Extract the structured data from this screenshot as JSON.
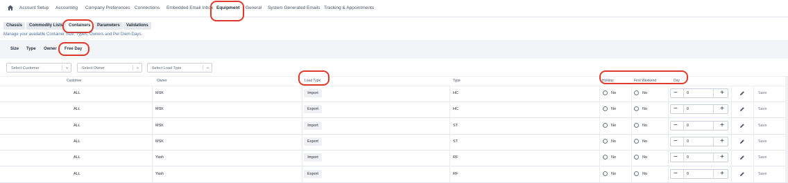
{
  "nav": {
    "items": [
      "Account Setup",
      "Accounting",
      "Company Preferences",
      "Connections",
      "Embedded Email Inbox",
      "Equipment",
      "General",
      "System Generated Emails",
      "Tracking & Appointments"
    ],
    "active": "Equipment"
  },
  "subtabs": [
    "Chassis",
    "Commodity Lists",
    "Containers",
    "Parameters",
    "Validations"
  ],
  "description": "Manage your available Container Size, Types, Owners and Per Diem Days.",
  "pills": [
    "Size",
    "Type",
    "Owner",
    "Free Day"
  ],
  "filters": [
    {
      "placeholder": "Select Customer"
    },
    {
      "placeholder": "Select Owner"
    },
    {
      "placeholder": "Select Load Type"
    }
  ],
  "columns": {
    "customer": "Customer",
    "owner": "Owner",
    "load_type": "Load Type",
    "type": "Type",
    "holiday": "Holiday",
    "first_weekend": "First Weekend",
    "day": "Day"
  },
  "rows": [
    {
      "customer": "ALL",
      "owner": "MSK",
      "load_type": "Import",
      "type": "HC",
      "holiday": "No",
      "first_weekend": "No",
      "day": "0",
      "save": "Save"
    },
    {
      "customer": "ALL",
      "owner": "MSK",
      "load_type": "Export",
      "type": "HC",
      "holiday": "No",
      "first_weekend": "No",
      "day": "0",
      "save": "Save"
    },
    {
      "customer": "ALL",
      "owner": "MSK",
      "load_type": "Import",
      "type": "ST",
      "holiday": "No",
      "first_weekend": "No",
      "day": "0",
      "save": "Save"
    },
    {
      "customer": "ALL",
      "owner": "MSK",
      "load_type": "Export",
      "type": "ST",
      "holiday": "No",
      "first_weekend": "No",
      "day": "0",
      "save": "Save"
    },
    {
      "customer": "ALL",
      "owner": "Yash",
      "load_type": "Import",
      "type": "RF",
      "holiday": "No",
      "first_weekend": "No",
      "day": "0",
      "save": "Save"
    },
    {
      "customer": "ALL",
      "owner": "Yash",
      "load_type": "Export",
      "type": "RF",
      "holiday": "No",
      "first_weekend": "No",
      "day": "0",
      "save": "Save"
    }
  ],
  "colors": {
    "highlight": "#e0392b",
    "band": "#f2f4f8"
  }
}
